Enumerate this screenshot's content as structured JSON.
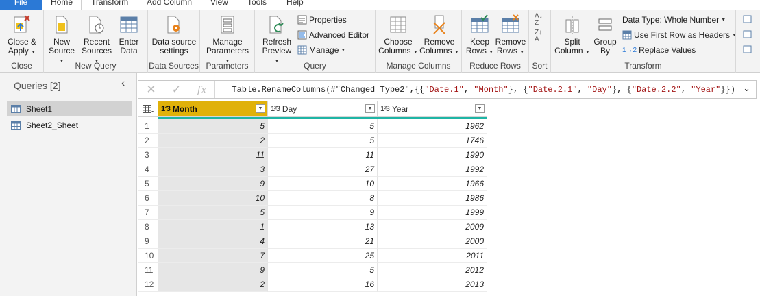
{
  "tabs": [
    "File",
    "Home",
    "Transform",
    "Add Column",
    "View",
    "Tools",
    "Help"
  ],
  "ribbon": {
    "close_apply": [
      "Close &",
      "Apply"
    ],
    "close_group": "Close",
    "new_source": [
      "New",
      "Source"
    ],
    "recent_sources": [
      "Recent",
      "Sources"
    ],
    "enter_data": [
      "Enter",
      "Data"
    ],
    "new_query_group": "New Query",
    "data_source_settings": [
      "Data source",
      "settings"
    ],
    "data_sources_group": "Data Sources",
    "manage_parameters": [
      "Manage",
      "Parameters"
    ],
    "parameters_group": "Parameters",
    "refresh_preview": [
      "Refresh",
      "Preview"
    ],
    "properties": "Properties",
    "advanced_editor": "Advanced Editor",
    "manage": "Manage",
    "query_group": "Query",
    "choose_columns": [
      "Choose",
      "Columns"
    ],
    "remove_columns": [
      "Remove",
      "Columns"
    ],
    "manage_columns_group": "Manage Columns",
    "keep_rows": [
      "Keep",
      "Rows"
    ],
    "remove_rows": [
      "Remove",
      "Rows"
    ],
    "reduce_rows_group": "Reduce Rows",
    "sort_group": "Sort",
    "split_column": [
      "Split",
      "Column"
    ],
    "group_by": [
      "Group",
      "By"
    ],
    "data_type": "Data Type: Whole Number",
    "use_first_row": "Use First Row as Headers",
    "replace_values": "Replace Values",
    "transform_group": "Transform"
  },
  "queries": {
    "title": "Queries [2]",
    "items": [
      "Sheet1",
      "Sheet2_Sheet"
    ]
  },
  "formula": {
    "prefix": "= Table.RenameColumns(#\"Changed Type2\",{{",
    "s1": "\"Date.1\"",
    "s2": "\"Month\"",
    "s3": "\"Date.2.1\"",
    "s4": "\"Day\"",
    "s5": "\"Date.2.2\"",
    "s6": "\"Year\"",
    "fx": "fx"
  },
  "table": {
    "type_icon": "1²3",
    "columns": [
      "Month",
      "Day",
      "Year"
    ],
    "rows": [
      [
        1,
        5,
        5,
        1962
      ],
      [
        2,
        2,
        5,
        1746
      ],
      [
        3,
        11,
        11,
        1990
      ],
      [
        4,
        3,
        27,
        1992
      ],
      [
        5,
        9,
        10,
        1966
      ],
      [
        6,
        10,
        8,
        1986
      ],
      [
        7,
        5,
        9,
        1999
      ],
      [
        8,
        1,
        13,
        2009
      ],
      [
        9,
        4,
        21,
        2000
      ],
      [
        10,
        7,
        25,
        2011
      ],
      [
        11,
        9,
        5,
        2012
      ],
      [
        12,
        2,
        16,
        2013
      ]
    ]
  },
  "colors": {
    "file_tab": "#2b79d6",
    "selected_header": "#e0b10a",
    "quality_bar": "#1fb5a5"
  }
}
